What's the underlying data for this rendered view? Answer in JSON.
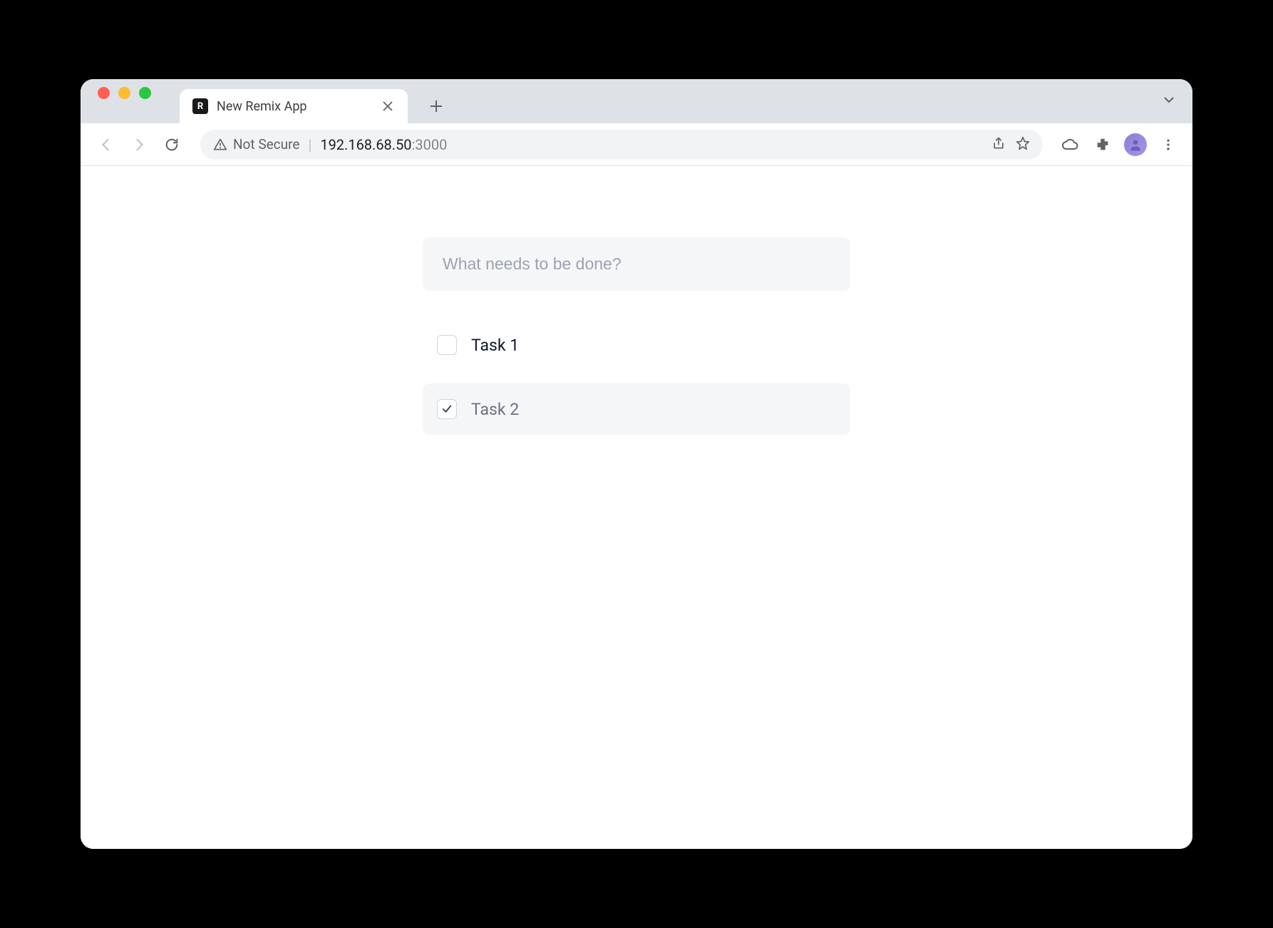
{
  "browser": {
    "tab": {
      "title": "New Remix App",
      "favicon_letter": "R"
    },
    "address": {
      "security_text": "Not Secure",
      "url_host": "192.168.68.50",
      "url_port": ":3000"
    }
  },
  "app": {
    "input_placeholder": "What needs to be done?",
    "todos": [
      {
        "label": "Task 1",
        "completed": false
      },
      {
        "label": "Task 2",
        "completed": true
      }
    ]
  }
}
